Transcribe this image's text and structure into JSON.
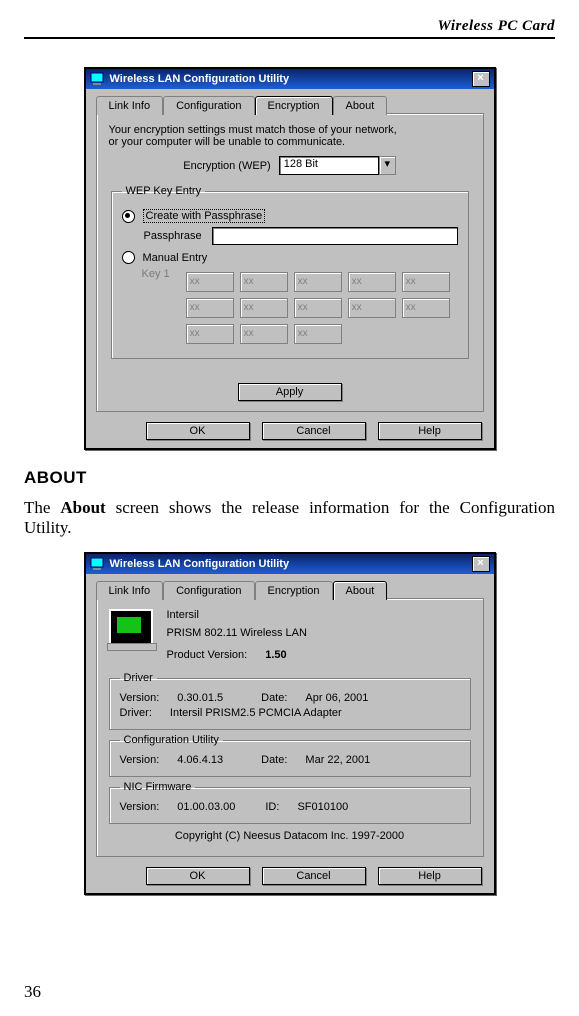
{
  "header": {
    "running_title": "Wireless  PC  Card"
  },
  "page_number": "36",
  "dlg1": {
    "title": "Wireless LAN Configuration Utility",
    "tabs": [
      "Link Info",
      "Configuration",
      "Encryption",
      "About"
    ],
    "selected_tab": "Encryption",
    "note_line1": "Your encryption settings must match those of your network,",
    "note_line2": "or your computer will be unable to communicate.",
    "enc_label": "Encryption (WEP)",
    "enc_value": "128 Bit",
    "group_title": "WEP Key Entry",
    "opt_create": "Create with Passphrase",
    "passphrase_label": "Passphrase",
    "opt_manual": "Manual Entry",
    "key1_label": "Key 1",
    "cell_placeholder": "xx",
    "btn_apply": "Apply",
    "btn_ok": "OK",
    "btn_cancel": "Cancel",
    "btn_help": "Help"
  },
  "section_heading": "ABOUT",
  "section_text_prefix": "The ",
  "section_text_bold": "About",
  "section_text_suffix": " screen shows the release information for the Configuration Utility.",
  "dlg2": {
    "title": "Wireless LAN Configuration Utility",
    "tabs": [
      "Link Info",
      "Configuration",
      "Encryption",
      "About"
    ],
    "selected_tab": "About",
    "vendor": "Intersil",
    "product": "PRISM 802.11 Wireless LAN",
    "pv_label": "Product Version:",
    "pv_value": "1.50",
    "driver": {
      "legend": "Driver",
      "ver_label": "Version:",
      "ver_value": "0.30.01.5",
      "date_label": "Date:",
      "date_value": "Apr 06, 2001",
      "drv_label": "Driver:",
      "drv_value": "Intersil PRISM2.5 PCMCIA Adapter"
    },
    "cfgutil": {
      "legend": "Configuration Utility",
      "ver_label": "Version:",
      "ver_value": "4.06.4.13",
      "date_label": "Date:",
      "date_value": "Mar 22, 2001"
    },
    "nic": {
      "legend": "NIC Firmware",
      "ver_label": "Version:",
      "ver_value": "01.00.03.00",
      "id_label": "ID:",
      "id_value": "SF010100"
    },
    "copyright": "Copyright (C) Neesus Datacom Inc. 1997-2000",
    "btn_ok": "OK",
    "btn_cancel": "Cancel",
    "btn_help": "Help"
  }
}
